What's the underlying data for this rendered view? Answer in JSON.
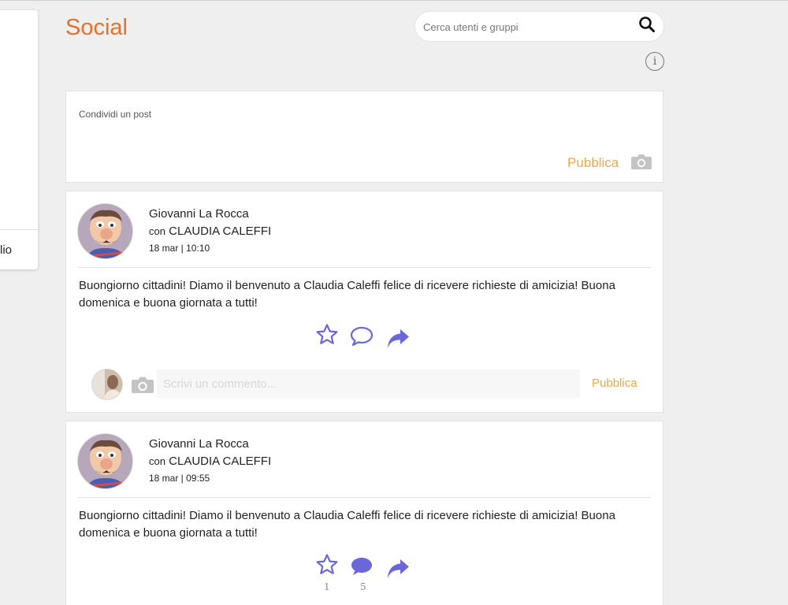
{
  "header": {
    "title": "Social",
    "search_placeholder": "Cerca utenti e gruppi",
    "search_icon": "search-icon",
    "info_icon": "info-icon",
    "info_glyph": "i"
  },
  "sidebar": {
    "partial_label": "lio"
  },
  "compose": {
    "placeholder": "Condividi un post",
    "publish_label": "Pubblica",
    "camera_icon": "camera-icon"
  },
  "posts": [
    {
      "author": "Giovanni La Rocca",
      "with_prefix": "con",
      "with_name": "CLAUDIA CALEFFI",
      "date": "18 mar | 10:10",
      "text": "Buongiorno cittadini! Diamo il benvenuto a Claudia Caleffi felice di ricevere richieste di amicizia! Buona domenica e buona giornata a tutti!",
      "like_count": "",
      "comment_count": "",
      "comment_placeholder": "Scrivi un commento...",
      "comment_publish_label": "Pubblica"
    },
    {
      "author": "Giovanni La Rocca",
      "with_prefix": "con",
      "with_name": "CLAUDIA CALEFFI",
      "date": "18 mar | 09:55",
      "text": "Buongiorno cittadini! Diamo il benvenuto a Claudia Caleffi felice di ricevere richieste di amicizia! Buona domenica e buona giornata a tutti!",
      "like_count": "1",
      "comment_count": "5"
    }
  ],
  "colors": {
    "accent": "#e07330",
    "publish": "#f0a848",
    "icon_purple": "#6a67d8",
    "background": "#efefef"
  }
}
